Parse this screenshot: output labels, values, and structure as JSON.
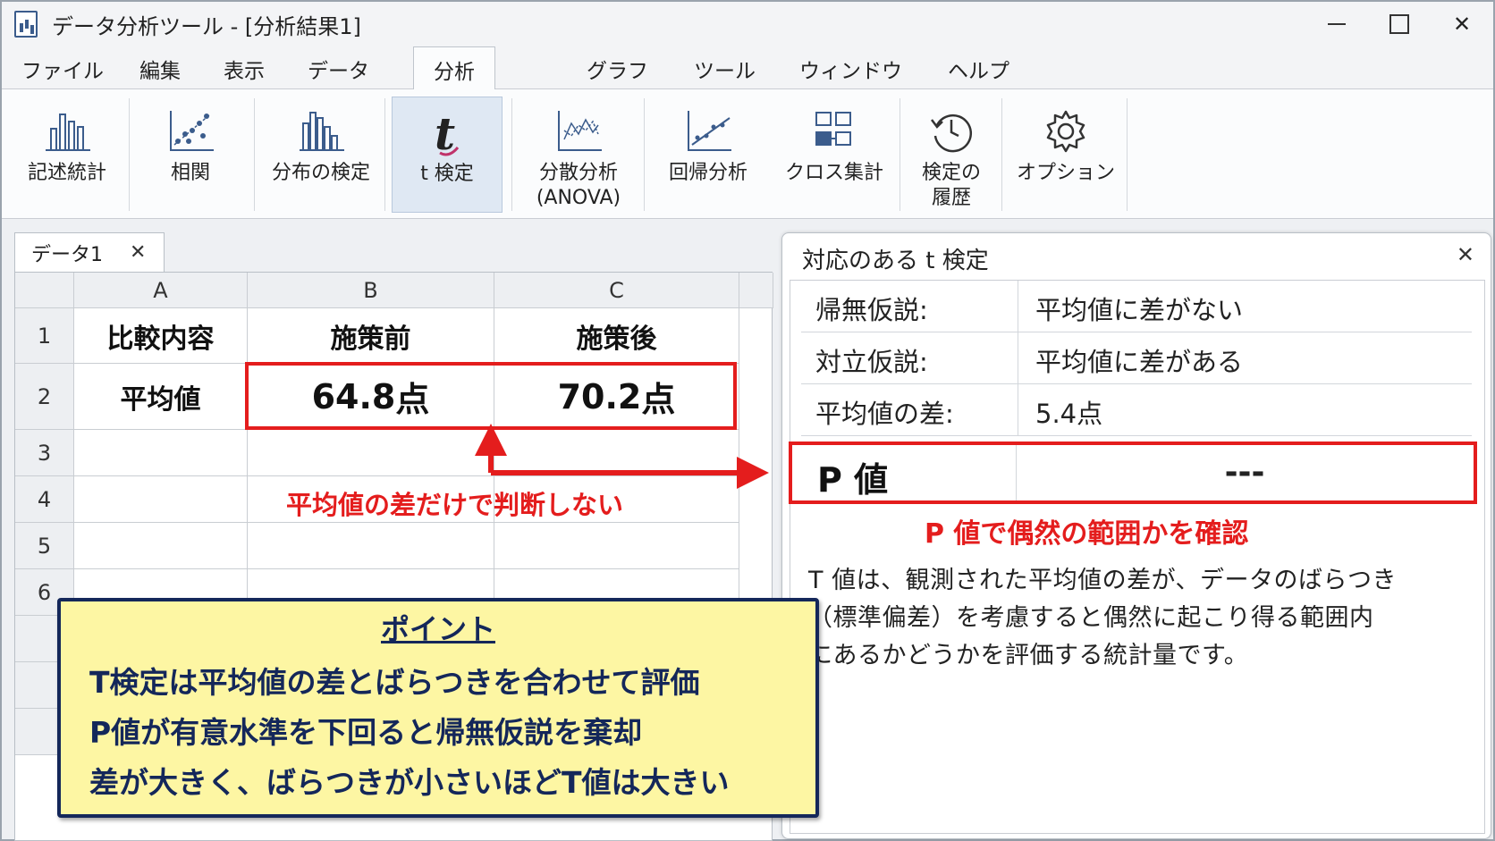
{
  "window": {
    "title": "データ分析ツール - [分析結果1]"
  },
  "menu": {
    "items": [
      "ファイル",
      "編集",
      "表示",
      "データ",
      "分析",
      "グラフ",
      "ツール",
      "ウィンドウ",
      "ヘルプ"
    ],
    "active": "分析"
  },
  "ribbon": {
    "buttons": [
      {
        "label": "記述統計",
        "icon": "bar-chart-icon"
      },
      {
        "label": "相関",
        "icon": "scatter-plot-icon"
      },
      {
        "label": "分布の検定",
        "icon": "histogram-icon"
      },
      {
        "label": "t 検定",
        "icon": "t-test-icon"
      },
      {
        "label": "分散分析",
        "label2": "(ANOVA)",
        "icon": "anova-icon"
      },
      {
        "label": "回帰分析",
        "icon": "regression-icon"
      },
      {
        "label": "クロス集計",
        "icon": "crosstab-icon"
      },
      {
        "label": "検定の",
        "label2": "履歴",
        "icon": "history-icon"
      },
      {
        "label": "オプション",
        "icon": "gear-icon"
      }
    ]
  },
  "sheet": {
    "tab_name": "データ1",
    "tab_close": "✕",
    "columns": [
      "A",
      "B",
      "C"
    ],
    "rows": [
      "1",
      "2",
      "3",
      "4",
      "5",
      "6"
    ],
    "cells": {
      "a1": "比較内容",
      "b1": "施策前",
      "c1": "施策後",
      "a2": "平均値",
      "b2_num": "64.8",
      "b2_unit": "点",
      "c2_num": "70.2",
      "c2_unit": "点"
    },
    "annotation": "平均値の差だけで判断しない"
  },
  "panel": {
    "title": "対応のある t 検定",
    "close": "✕",
    "rows": [
      {
        "key": "帰無仮説:",
        "value": "平均値に差がない"
      },
      {
        "key": "対立仮説:",
        "value": "平均値に差がある"
      },
      {
        "key": "平均値の差:",
        "value": "5.4点"
      }
    ],
    "p_key": "P 値",
    "p_value": "---",
    "annotation": "P 値で偶然の範囲かを確認",
    "description": [
      "T 値は、観測された平均値の差が、データのばらつき",
      "（標準偏差）を考慮すると偶然に起こり得る範囲内",
      "にあるかどうかを評価する統計量です。"
    ]
  },
  "point": {
    "title": "ポイント",
    "lines": [
      "T検定は平均値の差とばらつきを合わせて評価",
      "P値が有意水準を下回ると帰無仮説を棄却",
      "差が大きく、ばらつきが小さいほどT値は大きい"
    ]
  },
  "colors": {
    "accent_red": "#e41d1d",
    "point_bg": "#fdf6a3",
    "point_border": "#14275a",
    "ribbon_selected": "#dfe8f3"
  }
}
